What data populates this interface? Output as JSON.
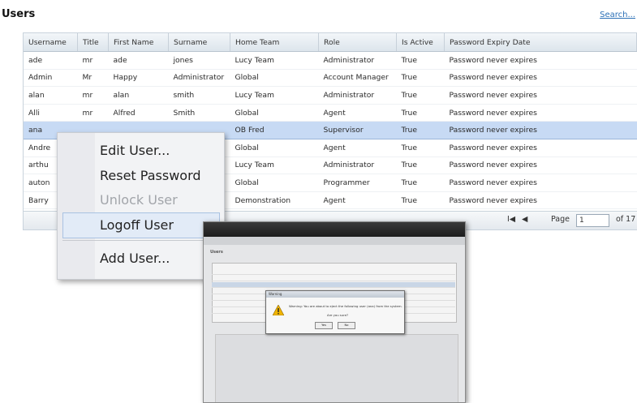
{
  "page": {
    "title": "Users",
    "search_link": "Search..."
  },
  "table": {
    "columns": [
      "Username",
      "Title",
      "First Name",
      "Surname",
      "Home Team",
      "Role",
      "Is Active",
      "Password Expiry Date"
    ],
    "rows": [
      [
        "ade",
        "mr",
        "ade",
        "jones",
        "Lucy Team",
        "Administrator",
        "True",
        "Password never expires"
      ],
      [
        "Admin",
        "Mr",
        "Happy",
        "Administrator",
        "Global",
        "Account Manager",
        "True",
        "Password never expires"
      ],
      [
        "alan",
        "mr",
        "alan",
        "smith",
        "Lucy Team",
        "Administrator",
        "True",
        "Password never expires"
      ],
      [
        "Alli",
        "mr",
        "Alfred",
        "Smith",
        "Global",
        "Agent",
        "True",
        "Password never expires"
      ],
      [
        "ana",
        "",
        "",
        "",
        "OB Fred",
        "Supervisor",
        "True",
        "Password never expires"
      ],
      [
        "Andre",
        "",
        "",
        "",
        "Global",
        "Agent",
        "True",
        "Password never expires"
      ],
      [
        "arthu",
        "",
        "",
        "",
        "Lucy Team",
        "Administrator",
        "True",
        "Password never expires"
      ],
      [
        "auton",
        "",
        "",
        "",
        "Global",
        "Programmer",
        "True",
        "Password never expires"
      ],
      [
        "Barry",
        "",
        "",
        "",
        "Demonstration",
        "Agent",
        "True",
        "Password never expires"
      ]
    ],
    "selected_row": 4
  },
  "pager": {
    "first": "I◀",
    "prev": "◀",
    "label": "Page",
    "page": "1",
    "of": "of 17",
    "next": "▶",
    "last": "▶I"
  },
  "context_menu": {
    "items": [
      {
        "label": "Edit User...",
        "disabled": false
      },
      {
        "label": "Reset Password",
        "disabled": false
      },
      {
        "label": "Unlock User",
        "disabled": true
      },
      {
        "label": "Logoff User",
        "disabled": false,
        "highlighted": true
      },
      {
        "label": "Add User...",
        "disabled": false
      }
    ]
  },
  "thumbnail": {
    "title": "Users",
    "dialog_title": "Warning",
    "dialog_message": "Warning: You are about to eject the following user (ana) from the system.",
    "dialog_question": "Are you sure?",
    "yes_label": "Yes",
    "no_label": "No"
  },
  "colors": {
    "link": "#2a6fb6",
    "selected_row": "#c7daf4",
    "menu_bg": "#f2f3f5"
  }
}
